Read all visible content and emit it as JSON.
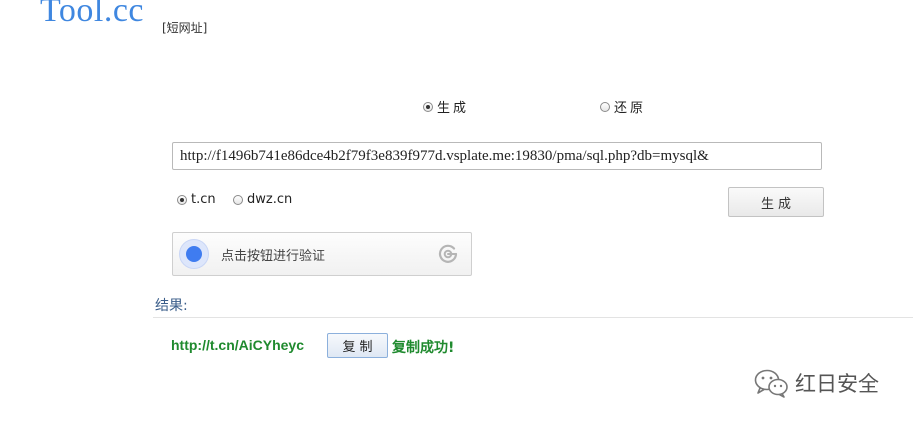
{
  "header": {
    "logo": "Tool.cc",
    "subtitle": "[短网址]"
  },
  "mode": {
    "options": [
      {
        "label": "生成",
        "checked": true
      },
      {
        "label": "还原",
        "checked": false
      }
    ]
  },
  "input": {
    "url_value": "http://f1496b741e86dce4b2f79f3e839f977d.vsplate.me:19830/pma/sql.php?db=mysql&"
  },
  "services": {
    "options": [
      {
        "label": "t.cn",
        "checked": true
      },
      {
        "label": "dwz.cn",
        "checked": false
      }
    ]
  },
  "actions": {
    "generate_label": "生成",
    "copy_label": "复制"
  },
  "captcha": {
    "text": "点击按钮进行验证"
  },
  "result": {
    "label": "结果:",
    "short_url": "http://t.cn/AiCYheyc",
    "copy_status": "复制成功!"
  },
  "watermark": {
    "text": "红日安全",
    "icon": "wechat-icon"
  }
}
